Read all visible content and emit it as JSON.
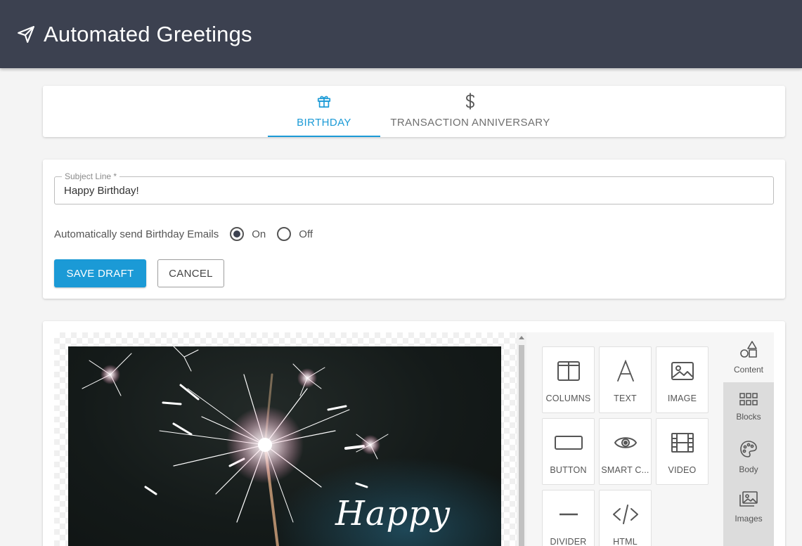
{
  "app": {
    "title": "Automated Greetings"
  },
  "tabs": [
    {
      "label": "BIRTHDAY",
      "icon": "gift-icon",
      "active": true
    },
    {
      "label": "TRANSACTION ANNIVERSARY",
      "icon": "dollar-icon",
      "active": false
    }
  ],
  "form": {
    "subject_label": "Subject Line *",
    "subject_value": "Happy Birthday!",
    "auto_send_label": "Automatically send Birthday Emails",
    "options": [
      "On",
      "Off"
    ],
    "selected_option": "On",
    "save_label": "SAVE DRAFT",
    "cancel_label": "CANCEL"
  },
  "canvas": {
    "image_text": "Happy"
  },
  "tools": [
    {
      "label": "COLUMNS",
      "icon": "columns-icon"
    },
    {
      "label": "TEXT",
      "icon": "text-icon"
    },
    {
      "label": "IMAGE",
      "icon": "image-icon"
    },
    {
      "label": "BUTTON",
      "icon": "button-icon"
    },
    {
      "label": "SMART C...",
      "icon": "eye-icon"
    },
    {
      "label": "VIDEO",
      "icon": "film-icon"
    },
    {
      "label": "DIVIDER",
      "icon": "divider-icon"
    },
    {
      "label": "HTML",
      "icon": "code-icon"
    }
  ],
  "sidenav": [
    {
      "label": "Content",
      "icon": "shapes-icon",
      "active": true
    },
    {
      "label": "Blocks",
      "icon": "grid-icon",
      "active": false
    },
    {
      "label": "Body",
      "icon": "palette-icon",
      "active": false
    },
    {
      "label": "Images",
      "icon": "images-icon",
      "active": false
    }
  ],
  "colors": {
    "header": "#3c4150",
    "accent": "#1b9ad6",
    "background": "#f4f4f4"
  }
}
